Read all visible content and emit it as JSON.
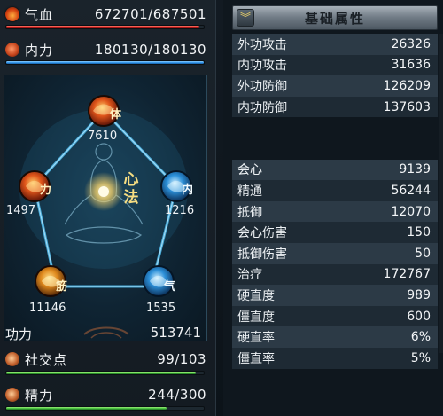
{
  "left": {
    "hp": {
      "label": "气血",
      "value": "672701/687501",
      "fill": 0.978
    },
    "mp": {
      "label": "内力",
      "value": "180130/180130",
      "fill": 1.0
    },
    "pentagon": {
      "center_label": "心法",
      "nodes": {
        "top": {
          "glyph": "体",
          "value": "7610"
        },
        "left": {
          "glyph": "力",
          "value": "1497"
        },
        "right": {
          "glyph": "内",
          "value": "1216"
        },
        "bottom_left": {
          "glyph": "筋",
          "value": "11146"
        },
        "bottom_right": {
          "glyph": "气",
          "value": "1535"
        }
      }
    },
    "merit": {
      "label": "功力",
      "value": "513741"
    },
    "social": {
      "label": "社交点",
      "value": "99/103",
      "fill": 0.961
    },
    "energy": {
      "label": "精力",
      "value": "244/300",
      "fill": 0.813
    }
  },
  "right": {
    "title": "基础属性",
    "collapse_icon": "double-chevron-down",
    "attributes": [
      {
        "name": "外功攻击",
        "value": "26326"
      },
      {
        "name": "内功攻击",
        "value": "31636"
      },
      {
        "name": "外功防御",
        "value": "126209"
      },
      {
        "name": "内功防御",
        "value": "137603"
      },
      {
        "name": "",
        "value": ""
      },
      {
        "name": "",
        "value": ""
      },
      {
        "name": "会心",
        "value": "9139"
      },
      {
        "name": "精通",
        "value": "56244"
      },
      {
        "name": "抵御",
        "value": "12070"
      },
      {
        "name": "会心伤害",
        "value": "150"
      },
      {
        "name": "抵御伤害",
        "value": "50"
      },
      {
        "name": "治疗",
        "value": "172767"
      },
      {
        "name": "硬直度",
        "value": "989"
      },
      {
        "name": "僵直度",
        "value": "600"
      },
      {
        "name": "硬直率",
        "value": "6%"
      },
      {
        "name": "僵直率",
        "value": "5%"
      }
    ]
  },
  "colors": {
    "hp_bar": "#d31d1d",
    "mp_bar": "#2b8ee6",
    "social_bar": "#3fb83a",
    "energy_bar": "#3fb83a",
    "title_bar": "#8a939c",
    "row_odd": "#2c3a46",
    "row_even": "#1e2a34"
  }
}
